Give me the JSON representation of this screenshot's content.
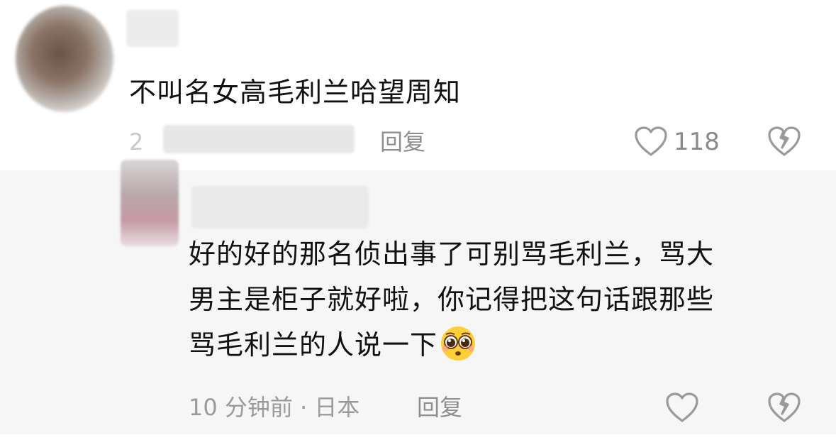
{
  "comments": [
    {
      "text": "不叫名女高毛利兰哈望周知",
      "date": "2",
      "reply_label": "回复",
      "like_count": "118"
    },
    {
      "text_line1": "好的好的那名侦出事了可别骂毛利兰，骂大",
      "text_line2": "男主是柜子就好啦，你记得把这句话跟那些",
      "text_line3": "骂毛利兰的人说一下",
      "meta": "10 分钟前 · 日本",
      "reply_label": "回复"
    }
  ],
  "icons": {
    "like": "heart-outline-icon",
    "dislike": "broken-heart-icon",
    "emoji": "pleading-face-emoji"
  }
}
